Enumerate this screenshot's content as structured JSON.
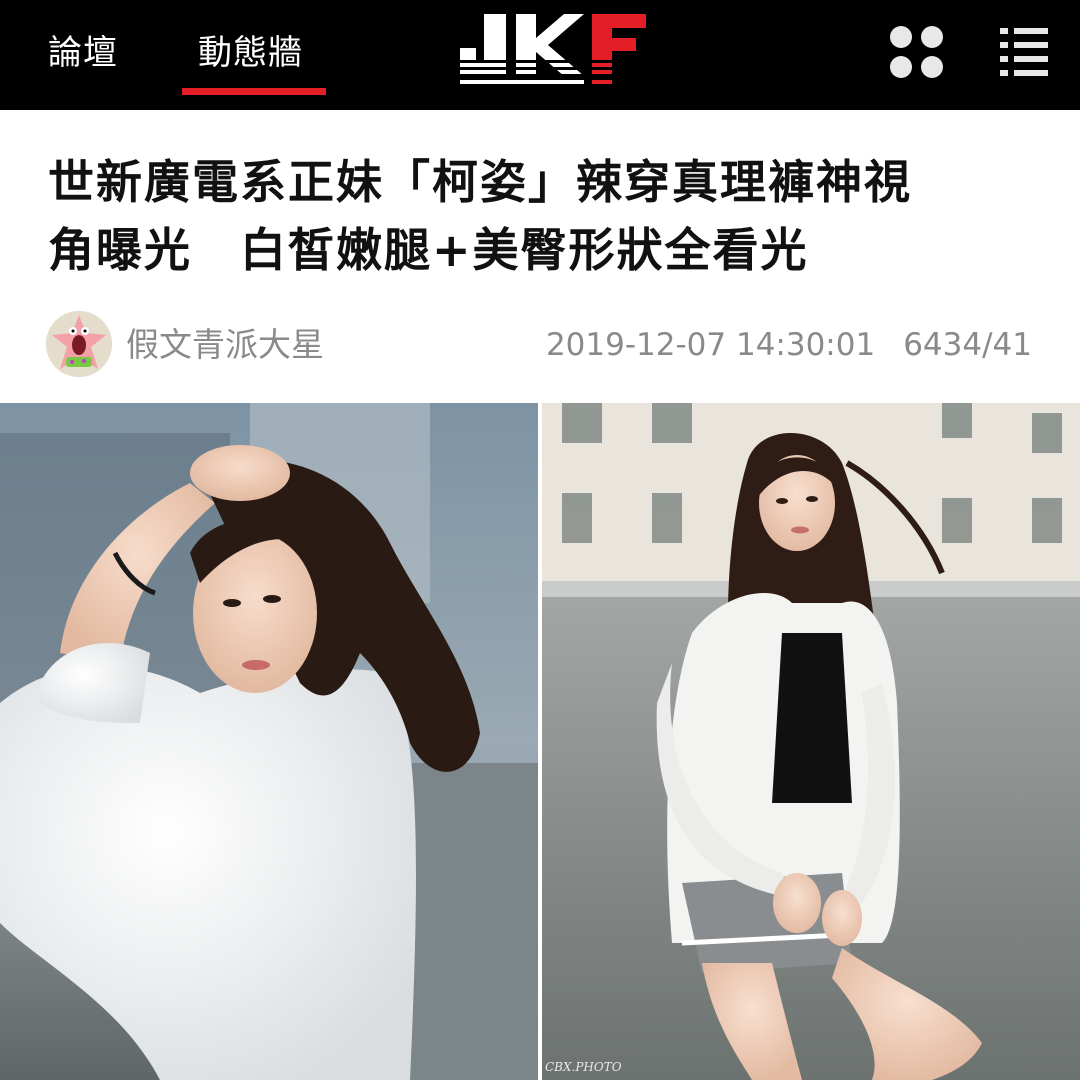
{
  "nav": {
    "tabs": [
      {
        "label": "論壇",
        "active": false
      },
      {
        "label": "動態牆",
        "active": true
      }
    ],
    "logo_text": "JKF",
    "accent_color": "#e31e26",
    "icons": [
      "apps-grid-icon",
      "menu-list-icon"
    ]
  },
  "article": {
    "title_line1": "世新廣電系正妹「柯姿」辣穿真理褲神視",
    "title_line2": "角曝光　白皙嫩腿+美臀形狀全看光",
    "author": "假文青派大星",
    "datetime": "2019-12-07 14:30:01",
    "stats": "6434/41"
  },
  "photos": {
    "watermark": "CBX.PHOTO"
  }
}
